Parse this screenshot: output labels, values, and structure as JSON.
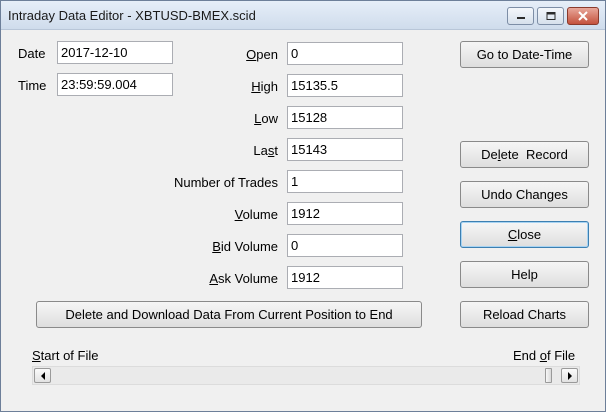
{
  "window": {
    "title": "Intraday Data Editor - XBTUSD-BMEX.scid",
    "controls": [
      "minimize-icon",
      "maximize-icon",
      "close-icon"
    ]
  },
  "record": {
    "date": {
      "label": "Date",
      "value": "2017-12-10"
    },
    "time": {
      "label": "Time",
      "value": "23:59:59.004"
    },
    "open": {
      "label_pre": "",
      "label_acc": "O",
      "label_post": "pen",
      "value": "0"
    },
    "high": {
      "label_pre": "",
      "label_acc": "H",
      "label_post": "igh",
      "value": "15135.5"
    },
    "low": {
      "label_pre": "",
      "label_acc": "L",
      "label_post": "ow",
      "value": "15128"
    },
    "last": {
      "label_pre": "La",
      "label_acc": "s",
      "label_post": "t",
      "value": "15143"
    },
    "num_trades": {
      "label": "Number of Trades",
      "value": "1"
    },
    "volume": {
      "label_pre": "",
      "label_acc": "V",
      "label_post": "olume",
      "value": "1912"
    },
    "bid_volume": {
      "label_pre": "",
      "label_acc": "B",
      "label_post": "id Volume",
      "value": "0"
    },
    "ask_volume": {
      "label_pre": "",
      "label_acc": "A",
      "label_post": "sk Volume",
      "value": "1912"
    }
  },
  "buttons": {
    "goto": "Go to Date-Time",
    "delete_pre": "De",
    "delete_acc": "l",
    "delete_post": "ete  Record",
    "undo": "Undo Changes",
    "close_acc": "C",
    "close_post": "lose",
    "help": "Help",
    "reload": "Reload Charts",
    "delete_download": "Delete and Download Data From Current Position to End"
  },
  "navigation": {
    "start_acc": "S",
    "start_post": "tart of File",
    "end_pre": "End ",
    "end_acc": "o",
    "end_post": "f File",
    "position": 0.985
  }
}
